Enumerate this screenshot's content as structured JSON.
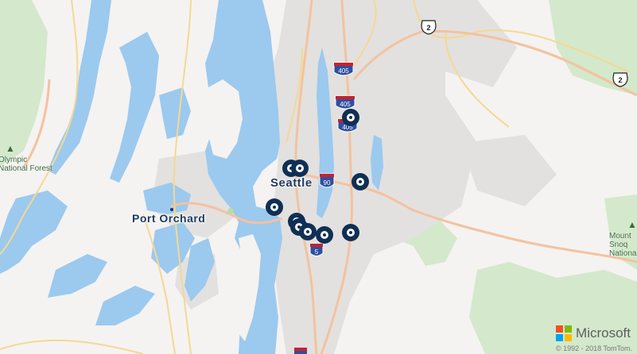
{
  "map": {
    "cities": {
      "seattle": "Seattle",
      "port_orchard": "Port Orchard"
    },
    "parks": {
      "olympic": "Olympic\nNational Forest",
      "snoqualmie": "Mount\nSnoq\nNationa"
    },
    "highways": {
      "i405_a": "405",
      "i405_b": "405",
      "i405_c": "405",
      "i90": "90",
      "i5": "5",
      "us2_a": "2",
      "us2_b": "2"
    },
    "pins_count": 10
  },
  "attribution": {
    "brand": "Microsoft",
    "copyright": "© 1992 - 2018 TomTom."
  },
  "colors": {
    "water": "#9cc9ee",
    "land": "#f4f3f1",
    "urban": "#e4e3e1",
    "park": "#cfe6c6",
    "major_road": "#f7c9a5",
    "minor_road": "#f6df9b",
    "pin": "#0f2f55",
    "interstate": "#2f4f9e",
    "interstate_top": "#c8202f"
  }
}
